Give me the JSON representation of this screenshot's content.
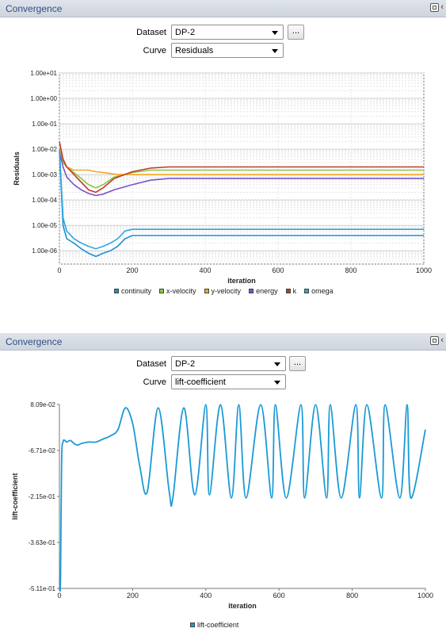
{
  "panels": [
    {
      "title": "Convergence",
      "dataset_label": "Dataset",
      "dataset_value": "DP-2",
      "curve_label": "Curve",
      "curve_value": "Residuals",
      "more_button": "...",
      "icons": [
        "restore-icon",
        "collapse-icon"
      ]
    },
    {
      "title": "Convergence",
      "dataset_label": "Dataset",
      "dataset_value": "DP-2",
      "curve_label": "Curve",
      "curve_value": "lift-coefficient",
      "more_button": "...",
      "icons": [
        "restore-icon",
        "collapse-icon"
      ]
    }
  ],
  "chart_data": [
    {
      "type": "line",
      "xlabel": "iteration",
      "ylabel": "Residuals",
      "y_scale": "log",
      "xlim": [
        0,
        1000
      ],
      "ylim": [
        3e-07,
        10
      ],
      "x_ticks": [
        "0",
        "200",
        "400",
        "600",
        "800",
        "1000"
      ],
      "y_ticks": [
        "1.00e+01",
        "1.00e+00",
        "1.00e-01",
        "1.00e-02",
        "1.00e-03",
        "1.00e-04",
        "1.00e-05",
        "1.00e-06"
      ],
      "grid": true,
      "legend_position": "bottom",
      "series": [
        {
          "name": "continuity",
          "color": "#1a8fcf",
          "x": [
            0,
            10,
            20,
            40,
            60,
            80,
            100,
            120,
            140,
            160,
            180,
            200,
            250,
            300,
            400,
            500,
            600,
            700,
            800,
            900,
            1000
          ],
          "y": [
            0.008,
            1e-05,
            3e-06,
            2e-06,
            1.2e-06,
            8e-07,
            6e-07,
            8e-07,
            1e-06,
            1.5e-06,
            3e-06,
            4e-06,
            4e-06,
            4e-06,
            4e-06,
            4e-06,
            4e-06,
            4e-06,
            4e-06,
            4e-06,
            4e-06
          ]
        },
        {
          "name": "x-velocity",
          "color": "#8cc63f",
          "x": [
            0,
            10,
            20,
            40,
            60,
            80,
            100,
            120,
            150,
            200,
            250,
            300,
            400,
            500,
            600,
            700,
            800,
            900,
            1000
          ],
          "y": [
            0.009,
            0.003,
            0.002,
            0.0012,
            0.0007,
            0.0004,
            0.0003,
            0.0004,
            0.0008,
            0.0012,
            0.0015,
            0.0015,
            0.0015,
            0.0015,
            0.0015,
            0.0015,
            0.0015,
            0.0015,
            0.0015
          ]
        },
        {
          "name": "y-velocity",
          "color": "#f5a623",
          "x": [
            0,
            10,
            20,
            40,
            60,
            80,
            100,
            120,
            140,
            160,
            180,
            200,
            250,
            300,
            400,
            500,
            600,
            700,
            800,
            900,
            1000
          ],
          "y": [
            0.01,
            0.004,
            0.002,
            0.0015,
            0.0015,
            0.0015,
            0.0013,
            0.0012,
            0.0011,
            0.001,
            0.001,
            0.001,
            0.001,
            0.001,
            0.001,
            0.001,
            0.001,
            0.001,
            0.001,
            0.001,
            0.001
          ]
        },
        {
          "name": "energy",
          "color": "#7b54c9",
          "x": [
            0,
            10,
            20,
            40,
            60,
            80,
            100,
            120,
            150,
            200,
            250,
            300,
            400,
            500,
            600,
            700,
            800,
            900,
            1000
          ],
          "y": [
            0.008,
            0.002,
            0.0008,
            0.0004,
            0.00025,
            0.00018,
            0.00015,
            0.00017,
            0.00025,
            0.0004,
            0.0006,
            0.0007,
            0.0007,
            0.0007,
            0.0007,
            0.0007,
            0.0007,
            0.0007,
            0.0007
          ]
        },
        {
          "name": "k",
          "color": "#c0392b",
          "x": [
            0,
            10,
            20,
            40,
            60,
            80,
            100,
            120,
            150,
            200,
            250,
            300,
            400,
            500,
            600,
            700,
            800,
            900,
            1000
          ],
          "y": [
            0.02,
            0.004,
            0.002,
            0.001,
            0.0005,
            0.00025,
            0.0002,
            0.0003,
            0.0007,
            0.0013,
            0.0018,
            0.002,
            0.002,
            0.002,
            0.002,
            0.002,
            0.002,
            0.002,
            0.002
          ]
        },
        {
          "name": "omega",
          "color": "#2aa6e0",
          "x": [
            0,
            10,
            20,
            40,
            60,
            80,
            100,
            120,
            140,
            160,
            180,
            200,
            250,
            300,
            400,
            500,
            600,
            700,
            800,
            900,
            1000
          ],
          "y": [
            0.01,
            2e-05,
            6e-06,
            3e-06,
            2e-06,
            1.5e-06,
            1.2e-06,
            1.5e-06,
            2e-06,
            3e-06,
            6e-06,
            7e-06,
            7e-06,
            7e-06,
            7e-06,
            7e-06,
            7e-06,
            7e-06,
            7e-06,
            7e-06,
            7e-06
          ]
        }
      ]
    },
    {
      "type": "line",
      "xlabel": "iteration",
      "ylabel": "lift-coefficient",
      "xlim": [
        0,
        1000
      ],
      "ylim": [
        -0.511,
        0.0809
      ],
      "x_ticks": [
        "0",
        "200",
        "400",
        "600",
        "800",
        "1000"
      ],
      "y_ticks": [
        "8.09e-02",
        "-6.71e-02",
        "-2.15e-01",
        "-3.63e-01",
        "-5.11e-01"
      ],
      "grid": false,
      "legend_position": "bottom",
      "series": [
        {
          "name": "lift-coefficient",
          "color": "#1a9ad6",
          "x": [
            0,
            3,
            6,
            10,
            15,
            20,
            30,
            40,
            50,
            60,
            80,
            100,
            120,
            140,
            160,
            180,
            200,
            220,
            240,
            270,
            300,
            310,
            340,
            370,
            400,
            410,
            440,
            470,
            490,
            510,
            550,
            580,
            590,
            620,
            660,
            670,
            700,
            730,
            740,
            770,
            810,
            820,
            840,
            880,
            890,
            930,
            950,
            960,
            1000
          ],
          "y": [
            -0.511,
            -0.48,
            -0.1,
            -0.04,
            -0.035,
            -0.04,
            -0.035,
            -0.045,
            -0.05,
            -0.045,
            -0.04,
            -0.04,
            -0.03,
            -0.02,
            0.0,
            0.07,
            0.02,
            -0.12,
            -0.2,
            0.07,
            -0.2,
            -0.22,
            0.07,
            -0.21,
            0.08,
            -0.21,
            0.08,
            -0.22,
            0.08,
            -0.22,
            0.08,
            -0.22,
            0.08,
            -0.22,
            0.08,
            -0.22,
            0.08,
            -0.22,
            0.08,
            -0.22,
            0.08,
            -0.22,
            0.08,
            -0.22,
            0.08,
            -0.22,
            0.08,
            -0.22,
            0.0
          ]
        }
      ]
    }
  ]
}
